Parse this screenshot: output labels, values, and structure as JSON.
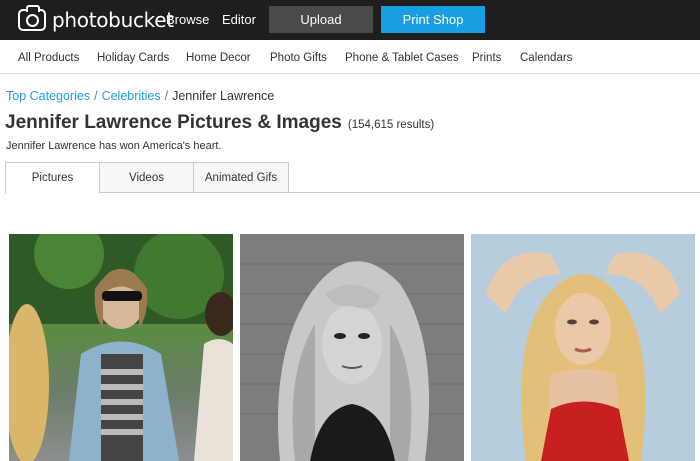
{
  "header": {
    "logo_text": "photobucket",
    "browse_label": "Browse",
    "editor_label": "Editor",
    "upload_label": "Upload",
    "print_shop_label": "Print Shop",
    "brand_color": "#1a9ee3"
  },
  "categories": [
    "All Products",
    "Holiday Cards",
    "Home Decor",
    "Photo Gifts",
    "Phone & Tablet Cases",
    "Prints",
    "Calendars"
  ],
  "breadcrumb": {
    "items": [
      "Top Categories",
      "Celebrities",
      "Jennifer Lawrence"
    ],
    "separator": "/"
  },
  "page": {
    "title": "Jennifer Lawrence Pictures & Images",
    "result_count": "(154,615 results)",
    "subtitle": "Jennifer Lawrence has won America's heart."
  },
  "tabs": [
    {
      "label": "Pictures",
      "active": true
    },
    {
      "label": "Videos",
      "active": false
    },
    {
      "label": "Animated Gifs",
      "active": false
    }
  ]
}
